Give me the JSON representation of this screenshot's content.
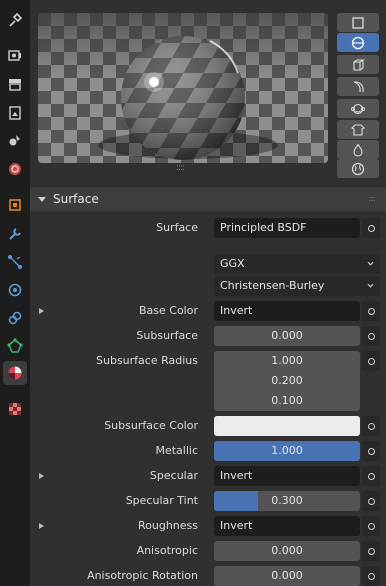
{
  "tabs": [
    {
      "name": "tool-tab-icon",
      "active": false
    },
    {
      "name": "render-tab-icon",
      "active": false
    },
    {
      "name": "output-tab-icon",
      "active": false
    },
    {
      "name": "view-layer-tab-icon",
      "active": false
    },
    {
      "name": "scene-tab-icon",
      "active": false
    },
    {
      "name": "world-tab-icon",
      "active": false
    },
    {
      "name": "object-tab-icon",
      "active": false
    },
    {
      "name": "modifiers-tab-icon",
      "active": false
    },
    {
      "name": "particles-tab-icon",
      "active": false
    },
    {
      "name": "physics-tab-icon",
      "active": false
    },
    {
      "name": "constraints-tab-icon",
      "active": false
    },
    {
      "name": "object-data-tab-icon",
      "active": false
    },
    {
      "name": "material-tab-icon",
      "active": true
    },
    {
      "name": "texture-tab-icon",
      "active": false
    }
  ],
  "preview_shapes": [
    "flat-icon",
    "sphere-icon",
    "cube-icon",
    "plane-icon",
    "monkey-icon",
    "cloth-icon",
    "fluid-icon",
    "world-icon"
  ],
  "panel": {
    "title": "Surface"
  },
  "surface": {
    "surface_label": "Surface",
    "surface_value": "Principled BSDF",
    "distribution": "GGX",
    "subsurface_method": "Christensen-Burley",
    "base_color_label": "Base Color",
    "base_color_value": "Invert",
    "subsurface_label": "Subsurface",
    "subsurface_value": "0.000",
    "subsurface_radius_label": "Subsurface Radius",
    "subsurface_radius": [
      "1.000",
      "0.200",
      "0.100"
    ],
    "subsurface_color_label": "Subsurface Color",
    "metallic_label": "Metallic",
    "metallic_value": "1.000",
    "metallic_fraction": 1.0,
    "specular_label": "Specular",
    "specular_value": "Invert",
    "specular_tint_label": "Specular Tint",
    "specular_tint_value": "0.300",
    "specular_tint_fraction": 0.3,
    "roughness_label": "Roughness",
    "roughness_value": "Invert",
    "anisotropic_label": "Anisotropic",
    "anisotropic_value": "0.000",
    "anisotropic_rotation_label": "Anisotropic Rotation",
    "anisotropic_rotation_value": "0.000"
  },
  "colors": {
    "accent": "#4772b3",
    "field_bg": "#545454",
    "subsurface_color": "#ececec"
  }
}
